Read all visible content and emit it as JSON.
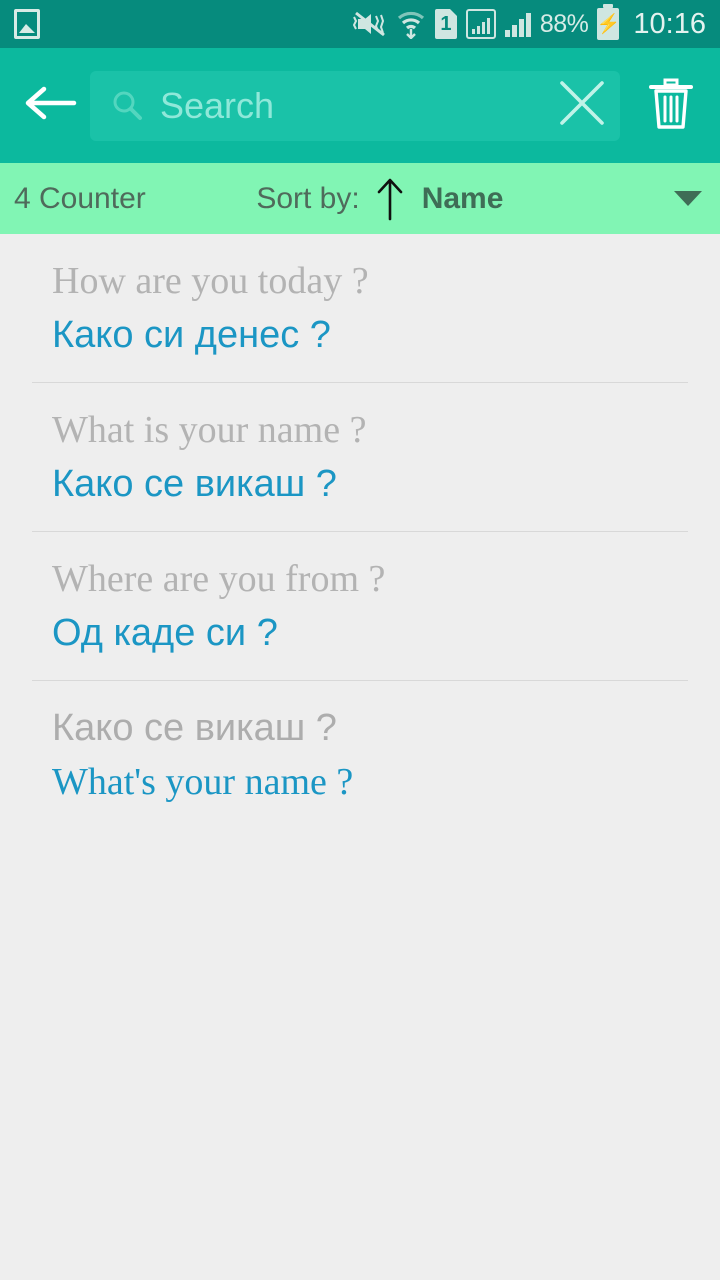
{
  "status_bar": {
    "background": "#068b7d",
    "gallery_icon": "gallery-icon",
    "mute_icon": "mute-vibrate-icon",
    "wifi_icon": "wifi-icon",
    "sim_label": "1",
    "signal_boxed_icon": "signal-boxed-icon",
    "signal_icon": "signal-icon",
    "battery_percent": "88%",
    "battery_icon": "battery-charging-icon",
    "time": "10:16"
  },
  "action_bar": {
    "background": "#0cb99e",
    "back_icon": "back-arrow-icon",
    "search": {
      "placeholder": "Search",
      "value": "",
      "icon": "search-icon",
      "clear_icon": "close-icon"
    },
    "delete_icon": "trash-icon"
  },
  "sort_bar": {
    "background": "#81f5b4",
    "counter_label": "4 Counter",
    "sort_by_label": "Sort by:",
    "sort_direction_icon": "arrow-up-icon",
    "sort_value": "Name",
    "dropdown_icon": "chevron-down-icon"
  },
  "list": {
    "items": [
      {
        "primary": "How are you today ?",
        "primary_script": "serif",
        "secondary": "Како си денес ?",
        "secondary_script": "sans",
        "divider": true
      },
      {
        "primary": "What is your name ?",
        "primary_script": "serif",
        "secondary": "Како се викаш ?",
        "secondary_script": "sans",
        "divider": true
      },
      {
        "primary": "Where are you from ?",
        "primary_script": "serif",
        "secondary": "Од каде си ?",
        "secondary_script": "sans",
        "divider": true
      },
      {
        "primary": "Како се викаш ?",
        "primary_script": "sans",
        "secondary": "What's your name ?",
        "secondary_script": "serif",
        "divider": false
      }
    ]
  },
  "colors": {
    "status_bar": "#068b7d",
    "action_bar": "#0cb99e",
    "search_field": "#1ac2a8",
    "sort_bar": "#81f5b4",
    "page_background": "#eeeeee",
    "primary_text": "#b3b3b3",
    "secondary_text": "#1b96c4",
    "sort_text": "#4f6a5b",
    "divider": "#d8d8d8"
  }
}
